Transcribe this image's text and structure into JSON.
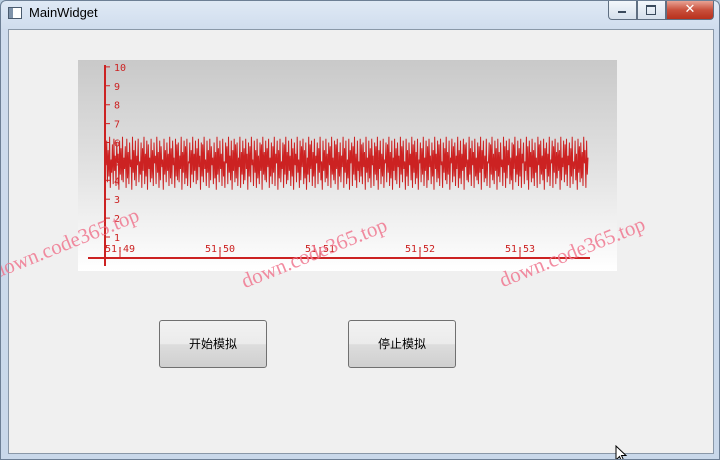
{
  "window": {
    "title": "MainWidget",
    "close_glyph": "✕"
  },
  "chart": {
    "color": "#cc2222",
    "y_ticks": [
      "1",
      "2",
      "3",
      "4",
      "5",
      "6",
      "7",
      "8",
      "9",
      "10"
    ],
    "x_ticks": [
      "51:49",
      "51:50",
      "51:51",
      "51:52",
      "51:53"
    ]
  },
  "buttons": {
    "start": "开始模拟",
    "stop": "停止模拟"
  },
  "watermark": [
    "down.code365.top",
    "down.code365.top",
    "down.code365.top"
  ],
  "chart_data": {
    "type": "line",
    "xlabel": "",
    "ylabel": "",
    "ylim": [
      0,
      10
    ],
    "x_ticks": [
      "51:49",
      "51:50",
      "51:51",
      "51:52",
      "51:53"
    ],
    "grid": false,
    "series": [
      {
        "values": [
          4.8,
          6.1,
          3.9,
          5.6,
          4.2,
          6.3,
          3.6,
          5.1,
          4.4,
          5.9,
          3.8,
          6.2,
          4.5,
          5.3,
          3.7,
          6.0,
          4.9,
          5.4,
          3.5,
          6.1,
          4.3,
          5.7,
          4.0,
          6.3,
          3.9,
          5.2,
          4.6,
          5.8,
          3.6,
          6.2,
          4.1,
          5.5,
          3.8,
          6.0,
          4.7,
          5.1,
          3.5,
          6.3,
          4.4,
          5.6,
          4.0,
          6.1,
          3.7,
          5.3,
          4.8,
          6.2,
          3.9,
          5.0,
          4.3,
          6.0,
          3.6,
          5.7,
          4.5,
          6.3,
          3.8,
          5.4,
          4.2,
          6.1,
          3.5,
          5.9,
          4.6,
          5.2,
          3.9,
          6.2,
          4.1,
          5.6,
          3.7,
          6.0,
          4.9,
          5.3,
          3.8,
          6.3,
          4.4,
          5.5,
          3.6,
          6.1,
          4.0,
          5.8,
          4.7,
          5.1,
          3.5,
          6.2,
          4.3,
          5.6,
          3.9,
          6.0,
          4.5,
          5.4,
          3.7,
          6.3,
          4.1,
          5.7,
          3.8,
          6.1,
          4.8,
          5.2,
          3.6,
          6.2,
          4.2,
          5.9,
          4.0,
          6.0,
          3.9,
          5.3,
          4.6,
          6.3,
          3.5,
          5.5,
          4.4,
          6.1,
          3.8,
          5.8,
          4.1,
          6.2,
          3.7,
          5.0,
          4.9,
          6.0,
          3.6,
          5.6,
          4.3,
          6.3,
          3.9,
          5.4,
          4.5,
          6.1,
          3.8,
          5.7,
          4.0,
          6.2,
          4.7,
          5.3,
          3.5,
          6.0,
          4.2,
          5.9,
          3.9,
          6.3,
          4.6,
          5.1,
          3.7,
          6.1,
          4.4,
          5.6,
          3.6,
          6.2,
          4.0,
          5.8,
          4.8,
          5.2,
          3.8,
          6.0,
          4.1,
          5.5,
          3.5,
          6.3,
          4.3,
          5.7,
          3.9,
          6.1,
          4.6,
          5.4,
          3.7,
          6.2,
          4.2,
          5.0,
          3.6,
          6.0,
          4.9,
          5.8,
          3.8,
          6.3,
          4.4,
          5.3,
          4.0,
          6.1,
          3.5,
          5.6,
          4.5,
          6.2,
          3.9,
          5.9,
          4.1,
          6.0,
          3.7,
          5.2,
          4.7,
          6.3,
          3.6,
          5.5,
          4.3,
          6.1,
          3.8,
          5.7,
          4.0,
          6.2,
          4.6,
          5.4,
          3.5,
          6.0,
          4.2,
          5.8,
          3.9,
          6.3,
          4.8,
          5.1,
          3.7,
          6.1,
          4.4,
          5.6,
          3.6,
          6.2,
          4.1,
          5.3,
          3.8,
          6.0,
          4.5,
          5.9,
          3.5,
          6.3,
          4.3,
          5.5,
          4.0,
          6.1,
          3.9,
          5.7,
          4.7,
          6.2,
          3.6,
          5.2,
          4.2,
          6.0,
          3.8,
          5.8,
          4.4,
          6.3,
          3.7,
          5.4,
          4.9,
          6.1,
          3.5,
          5.6,
          4.1,
          6.2,
          3.9,
          5.0,
          4.6,
          6.0,
          3.6,
          5.9,
          4.3,
          6.3,
          3.8,
          5.5,
          4.0,
          6.1,
          4.5,
          5.3,
          3.7,
          6.2,
          4.2,
          5.7,
          3.5,
          6.0,
          4.8,
          5.4,
          3.9,
          6.3,
          4.4,
          5.1,
          3.6,
          6.1,
          4.0,
          5.8,
          4.7,
          6.2,
          3.8,
          5.6,
          4.1,
          6.0,
          3.5,
          5.2,
          4.3,
          6.3,
          3.9,
          5.9,
          4.6,
          6.1,
          3.7,
          5.5,
          4.2,
          6.2,
          3.6,
          5.3,
          4.9,
          6.0,
          3.8,
          5.7,
          4.4,
          6.3,
          4.0,
          5.0,
          3.5,
          6.1,
          4.5,
          5.6,
          3.9,
          6.2,
          4.1,
          5.4,
          3.7,
          6.0,
          4.8,
          5.8,
          3.6,
          6.3,
          4.3,
          5.2,
          4.0,
          6.1,
          3.8,
          5.9,
          4.6,
          6.2,
          3.5,
          5.5,
          4.2,
          6.0,
          3.9,
          5.3,
          4.7,
          6.3,
          3.6,
          5.7,
          4.4,
          6.1,
          3.8,
          5.1,
          4.1,
          6.2,
          3.5,
          5.6,
          4.9,
          6.0,
          3.7,
          5.8,
          4.3,
          6.3,
          4.0,
          5.4,
          3.6,
          6.1,
          4.5,
          5.0,
          3.9,
          6.2,
          4.2,
          5.9,
          3.8,
          6.0,
          4.7,
          5.5,
          3.5,
          6.3,
          4.4,
          5.2,
          3.9,
          6.1,
          4.1,
          5.7,
          3.6,
          6.2,
          4.8,
          5.3,
          3.7,
          6.0,
          4.3,
          5.8,
          4.0,
          6.3,
          3.5,
          5.6,
          4.6,
          6.1,
          3.8,
          5.4,
          4.2,
          6.2,
          3.6,
          5.1,
          4.9,
          6.0,
          3.9,
          5.9,
          4.4,
          6.3,
          3.7,
          5.5,
          4.1,
          6.1,
          3.5,
          5.2,
          4.5,
          6.2,
          4.0,
          5.7,
          3.8,
          6.0,
          4.7,
          5.3,
          3.6,
          6.3,
          4.3,
          5.8,
          3.9,
          6.1,
          4.6,
          5.0,
          3.5,
          6.2,
          4.2,
          5.6,
          3.7,
          6.0,
          4.8,
          5.4,
          4.0,
          6.3,
          3.6,
          5.9,
          4.4,
          6.1,
          3.8,
          5.5,
          4.1,
          6.2,
          3.5,
          5.1,
          4.9,
          6.0,
          3.9,
          5.7,
          4.3,
          6.3,
          3.7,
          5.2,
          4.5,
          6.1,
          3.6,
          5.8,
          4.0,
          6.2,
          4.7,
          5.3,
          3.8,
          6.0,
          4.2,
          5.6,
          3.5,
          6.3,
          4.6,
          5.4,
          3.9,
          6.1,
          4.1,
          5.9,
          3.7,
          6.2,
          4.8,
          5.0,
          3.6,
          6.0,
          4.4,
          5.7,
          4.0,
          6.3,
          3.8,
          5.5,
          4.3,
          6.1,
          3.5,
          5.2,
          4.9,
          6.2,
          3.9,
          5.8,
          4.2,
          6.0,
          3.7,
          5.3,
          4.6,
          6.3,
          3.6,
          5.6,
          4.1,
          6.1,
          3.8,
          5.4,
          4.5,
          6.2,
          3.5,
          5.9,
          4.7,
          6.0,
          4.0,
          5.1,
          3.9,
          6.3,
          4.3,
          5.7,
          3.7,
          6.1,
          4.8,
          5.5,
          3.6,
          6.2,
          4.2,
          5.2,
          4.0,
          6.0,
          3.8,
          5.8,
          4.4,
          6.3,
          3.5,
          5.6,
          4.6,
          6.1,
          3.9,
          5.3,
          4.1,
          6.2,
          3.7,
          5.0,
          4.9,
          6.0,
          3.6,
          5.9,
          4.3,
          6.3,
          4.0,
          5.4,
          3.8,
          6.1,
          4.5,
          5.7,
          3.5,
          6.2,
          4.2,
          5.5,
          3.9,
          6.0,
          4.7,
          5.1,
          3.7,
          6.3,
          4.4,
          5.8,
          3.6,
          6.1,
          4.1,
          5.6,
          4.8,
          6.2,
          3.8,
          5.2,
          4.0,
          6.0,
          3.5,
          5.9,
          4.6,
          6.3,
          3.9,
          5.3,
          4.3,
          6.1,
          3.7,
          5.7,
          4.2,
          6.2,
          3.6,
          5.4,
          4.9,
          6.0,
          3.8,
          5.0,
          4.5,
          6.3,
          4.0,
          5.8,
          3.5,
          6.1,
          4.7,
          5.5,
          3.9,
          6.2,
          4.1,
          5.6,
          3.7,
          6.0,
          4.4,
          5.2,
          3.6,
          6.3,
          4.8,
          5.9,
          3.8,
          6.1,
          4.3,
          5.3,
          4.0,
          6.2,
          3.5,
          5.7,
          4.6,
          6.0,
          3.9,
          5.4,
          4.2,
          6.3,
          3.7,
          5.1,
          4.9,
          6.1,
          3.6,
          5.8,
          4.4,
          6.2,
          3.8,
          5.5,
          4.1,
          6.0,
          4.5,
          5.6,
          3.5,
          6.3,
          4.0,
          5.2,
          4.7,
          6.1,
          3.9,
          5.9,
          4.3,
          6.2,
          3.7,
          5.3,
          4.8,
          6.0,
          3.6,
          5.7,
          4.2,
          6.3,
          3.8,
          5.0,
          4.6,
          6.1,
          4.0,
          5.4,
          3.5,
          6.2,
          4.4,
          5.8,
          3.9,
          6.0,
          4.1,
          5.5,
          3.7,
          6.3,
          4.9,
          5.6,
          3.6,
          6.1,
          4.3,
          5.2
        ]
      }
    ]
  }
}
